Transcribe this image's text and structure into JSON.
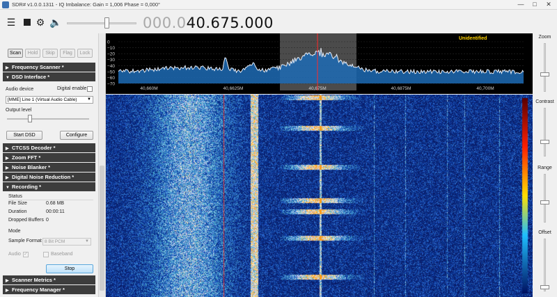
{
  "window": {
    "title": "SDR# v1.0.0.1311 - IQ Imbalance: Gain = 1,006 Phase = 0,000°",
    "minimize": "—",
    "maximize": "□",
    "close": "✕"
  },
  "toolbar": {
    "frequency_prefix": "000.0",
    "frequency_main": "40.675.000",
    "volume_level": 0.55
  },
  "scanner_buttons": [
    "Scan",
    "Hold",
    "Skip",
    "Flag",
    "Lock"
  ],
  "sections": {
    "frequency_scanner": "Frequency Scanner *",
    "dsd_interface": "DSD Interface *",
    "ctcss_decoder": "CTCSS Decoder *",
    "zoom_fft": "Zoom FFT *",
    "noise_blanker": "Noise Blanker *",
    "digital_noise_reduction": "Digital Noise Reduction *",
    "recording": "Recording *",
    "scanner_metrics": "Scanner Metrics *",
    "frequency_manager": "Frequency Manager *"
  },
  "dsd": {
    "audio_device_label": "Audio device",
    "digital_enable_label": "Digital enable",
    "audio_device_value": "[MME] Line 1 (Virtual Audio Cable)",
    "output_level_label": "Output level",
    "output_level": 0.32,
    "start_button": "Start DSD",
    "configure_button": "Configure"
  },
  "recording": {
    "status_label": "Status",
    "file_size_label": "File Size",
    "file_size_value": "0.68 MB",
    "duration_label": "Duration",
    "duration_value": "00:00:11",
    "dropped_label": "Dropped Buffers",
    "dropped_value": "0",
    "mode_label": "Mode",
    "sample_format_label": "Sample Format",
    "sample_format_value": "8 Bit PCM",
    "audio_label": "Audio",
    "audio_checked": "✓",
    "baseband_label": "Baseband",
    "stop_button": "Stop"
  },
  "spectrum": {
    "label": "Unidentified",
    "y_ticks": [
      "0",
      "−10",
      "−20",
      "−30",
      "−40",
      "−50",
      "−60",
      "−70"
    ],
    "x_ticks": [
      "40,660M",
      "40,6625M",
      "40,675M",
      "40,6875M",
      "40,700M"
    ],
    "trace_color": "#e8eef8",
    "center_line_color": "#ff2a2a",
    "label_color": "#ffd200"
  },
  "right_controls": {
    "zoom_label": "Zoom",
    "contrast_label": "Contrast",
    "range_label": "Range",
    "offset_label": "Offset"
  }
}
